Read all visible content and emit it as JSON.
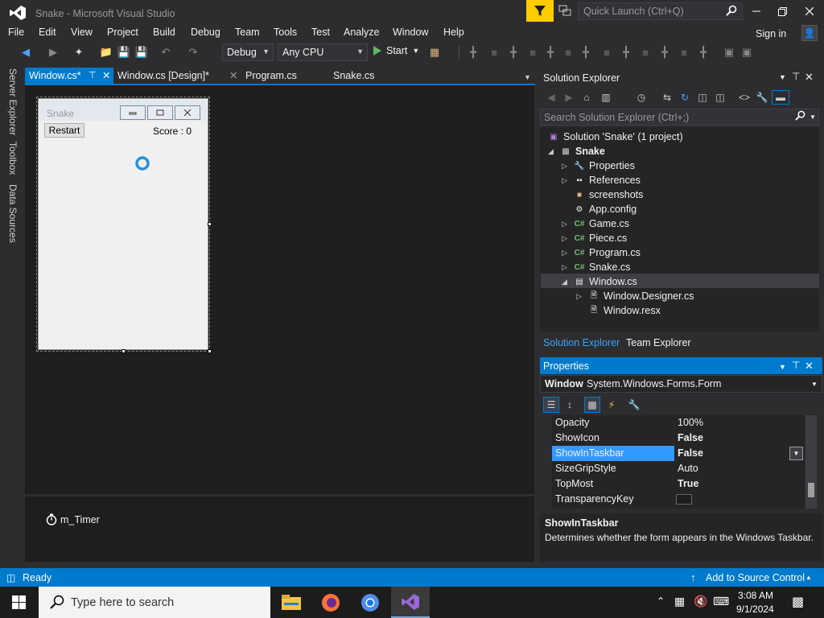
{
  "window": {
    "title": "Snake - Microsoft Visual Studio",
    "quick_launch_placeholder": "Quick Launch (Ctrl+Q)"
  },
  "menu": [
    "File",
    "Edit",
    "View",
    "Project",
    "Build",
    "Debug",
    "Team",
    "Tools",
    "Test",
    "Analyze",
    "Window",
    "Help"
  ],
  "signin": "Sign in",
  "toolbar": {
    "config": "Debug",
    "platform": "Any CPU",
    "start": "Start"
  },
  "side_tabs": [
    "Server Explorer",
    "Toolbox",
    "Data Sources"
  ],
  "doc_tabs": [
    {
      "label": "Window.cs*",
      "active": true
    },
    {
      "label": "Window.cs [Design]*",
      "active": false
    },
    {
      "label": "Program.cs",
      "active": false
    },
    {
      "label": "Snake.cs",
      "active": false
    }
  ],
  "form": {
    "title": "Snake",
    "restart_label": "Restart",
    "score_label": "Score : 0"
  },
  "tray": {
    "component": "m_Timer"
  },
  "solution_explorer": {
    "title": "Solution Explorer",
    "search_placeholder": "Search Solution Explorer (Ctrl+;)",
    "solution": "Solution 'Snake' (1 project)",
    "project": "Snake",
    "items": [
      "Properties",
      "References",
      "screenshots",
      "App.config",
      "Game.cs",
      "Piece.cs",
      "Program.cs",
      "Snake.cs",
      "Window.cs"
    ],
    "children": [
      "Window.Designer.cs",
      "Window.resx"
    ],
    "tabs": [
      "Solution Explorer",
      "Team Explorer"
    ]
  },
  "properties": {
    "title": "Properties",
    "object": "Window",
    "object_type": "System.Windows.Forms.Form",
    "rows": [
      {
        "name": "Opacity",
        "value": "100%"
      },
      {
        "name": "ShowIcon",
        "value": "False"
      },
      {
        "name": "ShowInTaskbar",
        "value": "False"
      },
      {
        "name": "SizeGripStyle",
        "value": "Auto"
      },
      {
        "name": "TopMost",
        "value": "True"
      },
      {
        "name": "TransparencyKey",
        "value": ""
      }
    ],
    "desc_title": "ShowInTaskbar",
    "desc_text": "Determines whether the form appears in the Windows Taskbar."
  },
  "status": {
    "text": "Ready",
    "source_control": "Add to Source Control"
  },
  "taskbar": {
    "search_placeholder": "Type here to search",
    "time": "3:08 AM",
    "date": "9/1/2024"
  },
  "colors": {
    "accent": "#007acc",
    "bg": "#2d2d30",
    "panel": "#252526",
    "filter": "#ffcc00"
  }
}
